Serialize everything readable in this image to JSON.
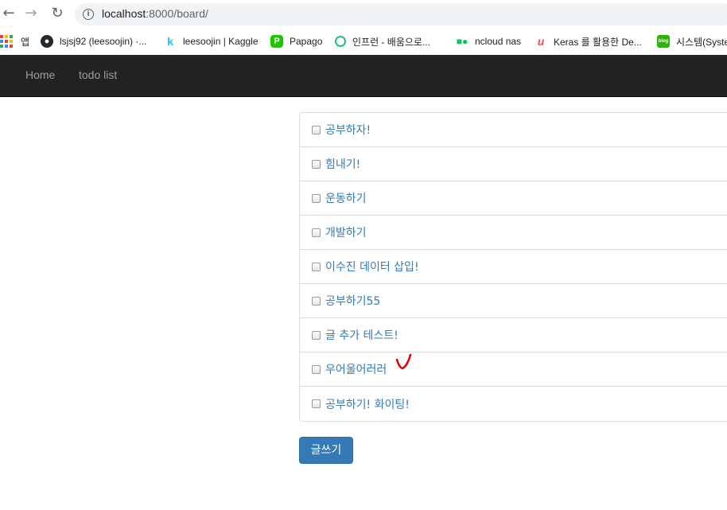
{
  "browser": {
    "url_host": "localhost",
    "url_rest": ":8000/board/",
    "bookmarks": [
      {
        "label": "앱",
        "icon": "apps-grid-icon"
      },
      {
        "label": "lsjsj92 (leesoojin) ·...",
        "icon": "github-icon"
      },
      {
        "label": "leesoojin | Kaggle",
        "icon": "kaggle-icon"
      },
      {
        "label": "Papago",
        "icon": "papago-icon"
      },
      {
        "label": "인프런 - 배움으로...",
        "icon": "inflearn-icon"
      },
      {
        "label": "ncloud nas",
        "icon": "ncloud-icon"
      },
      {
        "label": "Keras 를 활용한 De...",
        "icon": "udemy-icon"
      },
      {
        "label": "시스템(Syste",
        "icon": "blog-icon"
      }
    ]
  },
  "navbar": {
    "home": "Home",
    "todo": "todo list"
  },
  "todos": [
    {
      "text": "공부하자!",
      "checked": false
    },
    {
      "text": "힘내기!",
      "checked": false
    },
    {
      "text": "운동하기",
      "checked": false
    },
    {
      "text": "개발하기",
      "checked": false
    },
    {
      "text": "이수진 데이터 삽입!",
      "checked": false
    },
    {
      "text": "공부하기55",
      "checked": false
    },
    {
      "text": "글 추가 테스트!",
      "checked": false
    },
    {
      "text": "우어울어러러",
      "checked": false
    },
    {
      "text": "공부하기! 화이팅!",
      "checked": false
    }
  ],
  "write_button": "글쓰기",
  "colors": {
    "navbar_bg": "#222222",
    "link": "#337ab7",
    "button": "#337ab7",
    "annotation": "#e00000"
  }
}
